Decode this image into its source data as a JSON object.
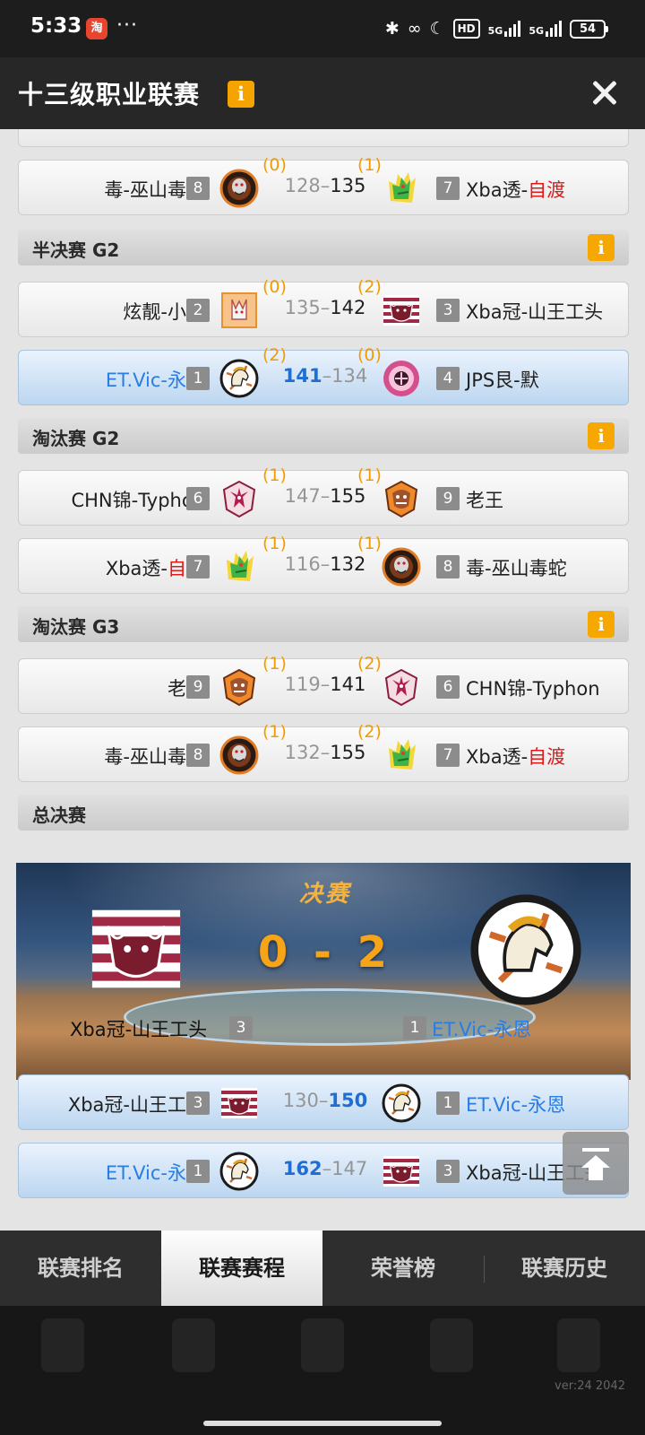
{
  "status_bar": {
    "time": "5:33",
    "app_icon_glyph": "淘",
    "dots": "···",
    "hd_label": "HD",
    "signal_1": "5G",
    "signal_2": "5G",
    "battery": "54"
  },
  "header": {
    "title": "十三级职业联赛",
    "info_glyph": "i",
    "close_icon": "close-icon"
  },
  "matches": [
    {
      "home_name": "毒-巫山毒蛇",
      "home_name_red": "",
      "home_seed": "8",
      "home_wins": "(0)",
      "home_score": "128",
      "away_score": "135",
      "away_wins": "(1)",
      "away_seed": "7",
      "away_name": "Xba透-",
      "away_name_red": "自渡"
    },
    {
      "home_name": "炫靓-小李",
      "home_name_red": "",
      "home_seed": "2",
      "home_wins": "(0)",
      "home_score": "135",
      "away_score": "142",
      "away_wins": "(2)",
      "away_seed": "3",
      "away_name": "Xba冠-山王工头",
      "away_name_red": ""
    },
    {
      "home_name": "ET.Vic-永恩",
      "home_name_red": "",
      "home_seed": "1",
      "home_wins": "(2)",
      "home_score": "141",
      "away_score": "134",
      "away_wins": "(0)",
      "away_seed": "4",
      "away_name": "JPS艮-默",
      "away_name_red": ""
    },
    {
      "home_name": "CHN锦-Typhon",
      "home_name_red": "",
      "home_seed": "6",
      "home_wins": "(1)",
      "home_score": "147",
      "away_score": "155",
      "away_wins": "(1)",
      "away_seed": "9",
      "away_name": "老王",
      "away_name_red": ""
    },
    {
      "home_name": "Xba透-",
      "home_name_red": "自渡",
      "home_seed": "7",
      "home_wins": "(1)",
      "home_score": "116",
      "away_score": "132",
      "away_wins": "(1)",
      "away_seed": "8",
      "away_name": "毒-巫山毒蛇",
      "away_name_red": ""
    },
    {
      "home_name": "老王",
      "home_name_red": "",
      "home_seed": "9",
      "home_wins": "(1)",
      "home_score": "119",
      "away_score": "141",
      "away_wins": "(2)",
      "away_seed": "6",
      "away_name": "CHN锦-Typhon",
      "away_name_red": ""
    },
    {
      "home_name": "毒-巫山毒蛇",
      "home_name_red": "",
      "home_seed": "8",
      "home_wins": "(1)",
      "home_score": "132",
      "away_score": "155",
      "away_wins": "(2)",
      "away_seed": "7",
      "away_name": "Xba透-",
      "away_name_red": "自渡"
    },
    {
      "home_name": "Xba冠-山王工头",
      "home_name_red": "",
      "home_seed": "3",
      "home_wins": "",
      "home_score": "130",
      "away_score": "150",
      "away_wins": "",
      "away_seed": "1",
      "away_name": "ET.Vic-永恩",
      "away_name_red": ""
    },
    {
      "home_name": "ET.Vic-永恩",
      "home_name_red": "",
      "home_seed": "1",
      "home_wins": "",
      "home_score": "162",
      "away_score": "147",
      "away_wins": "",
      "away_seed": "3",
      "away_name": "Xba冠-山王工头",
      "away_name_red": ""
    }
  ],
  "sections": {
    "semi_g2": "半决赛 G2",
    "elim_g2": "淘汰赛 G2",
    "elim_g3": "淘汰赛 G3",
    "finals": "总决赛",
    "info_glyph": "i"
  },
  "final": {
    "title": "决赛",
    "score": "0 - 2",
    "home_name": "Xba冠-山王工头",
    "home_seed": "3",
    "away_seed": "1",
    "away_name": "ET.Vic-永恩"
  },
  "tabs": [
    "联赛排名",
    "联赛赛程",
    "荣誉榜",
    "联赛历史"
  ],
  "active_tab": "联赛赛程",
  "version": "ver:24  2042",
  "colors": {
    "accent_orange": "#f6a800",
    "highlight_blue": "#bcd6f0",
    "winner_blue": "#1f6ed4",
    "name_red": "#e01919"
  }
}
